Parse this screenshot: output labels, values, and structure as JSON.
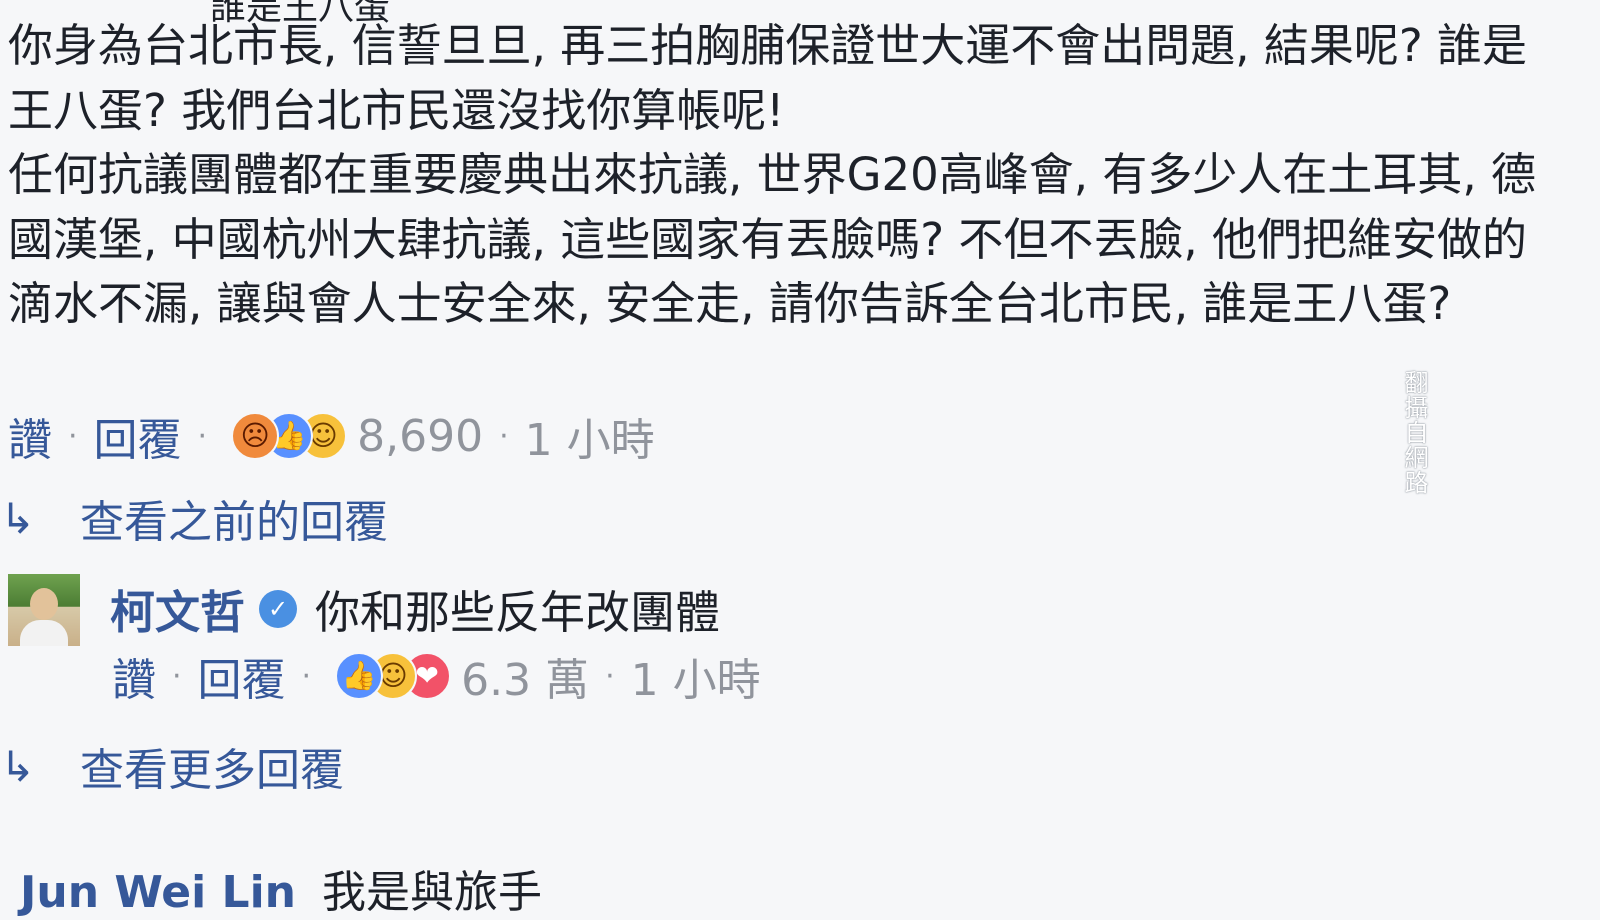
{
  "top_cut": "誰是王八蛋",
  "comment": {
    "paragraphs": [
      "你身為台北市長, 信誓旦旦, 再三拍胸脯保證世大運不會出問題, 結果呢? 誰是王八蛋? 我們台北市民還沒找你算帳呢!",
      "任何抗議團體都在重要慶典出來抗議, 世界G20高峰會, 有多少人在土耳其, 德國漢堡, 中國杭州大肆抗議, 這些國家有丟臉嗎? 不但不丟臉, 他們把維安做的滴水不漏, 讓與會人士安全來, 安全走, 請你告訴全台北市民, 誰是王八蛋?"
    ],
    "actions": {
      "like": "讚",
      "reply": "回覆",
      "dot": "·",
      "reaction_count": "8,690",
      "time": "1 小時",
      "reactions": [
        "angry-icon",
        "like-icon",
        "haha-icon"
      ]
    }
  },
  "view_previous_replies": "查看之前的回覆",
  "reply": {
    "author": "柯文哲",
    "verified_icon": "verified-badge-icon",
    "text": "你和那些反年改團體",
    "actions": {
      "like": "讚",
      "reply": "回覆",
      "dot": "·",
      "reaction_count": "6.3 萬",
      "time": "1 小時",
      "reactions": [
        "like-icon",
        "haha-icon",
        "love-icon"
      ]
    }
  },
  "view_more_replies": "查看更多回覆",
  "next_comment": {
    "author": "Jun Wei Lin",
    "text": "我是與旅手"
  },
  "watermark": "翻攝自網路",
  "colors": {
    "background": "#f6f7f9",
    "link": "#365899",
    "meta": "#90949c",
    "text": "#1d2129"
  }
}
